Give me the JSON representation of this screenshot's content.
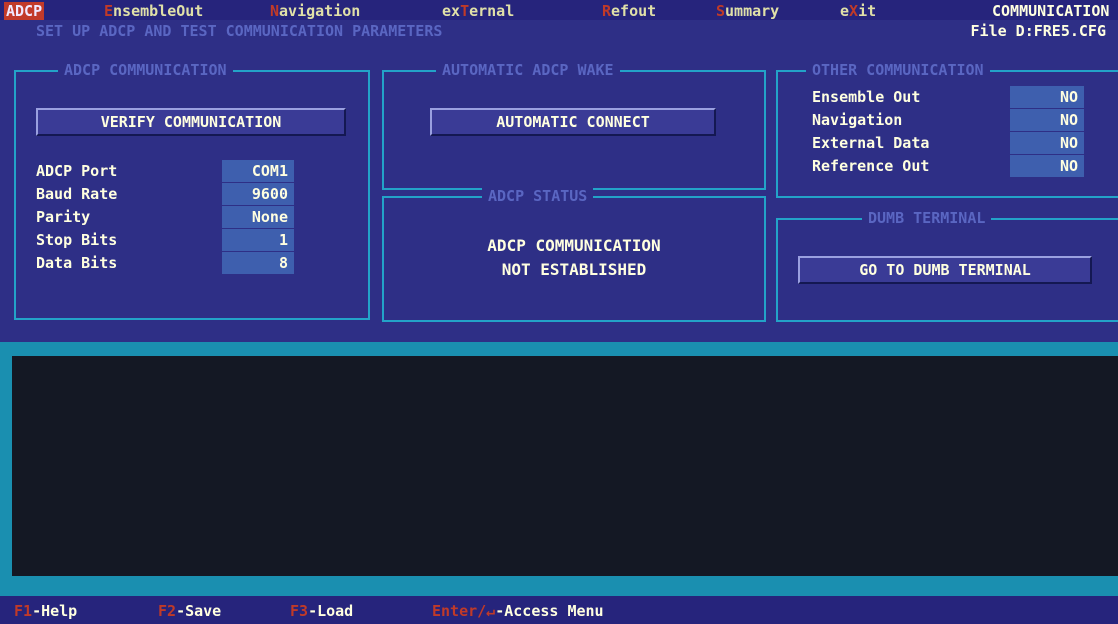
{
  "menu": {
    "adcp": "ADCP",
    "ensemble_hot": "E",
    "ensemble_rest": "nsembleOut",
    "nav_hot": "N",
    "nav_rest": "avigation",
    "ext_pre": "ex",
    "ext_hot": "T",
    "ext_rest": "ernal",
    "ref_hot": "R",
    "ref_rest": "efout",
    "sum_hot": "S",
    "sum_rest": "ummary",
    "exit_pre": "e",
    "exit_hot": "X",
    "exit_rest": "it",
    "current_screen": "COMMUNICATION"
  },
  "header": {
    "subtitle": "SET UP ADCP AND TEST COMMUNICATION PARAMETERS",
    "file": "File D:FRE5.CFG"
  },
  "adcp_comm": {
    "title": "ADCP COMMUNICATION",
    "verify_button": "VERIFY COMMUNICATION",
    "fields": [
      {
        "label": "ADCP Port",
        "value": "COM1"
      },
      {
        "label": "Baud Rate",
        "value": "9600"
      },
      {
        "label": "Parity",
        "value": "None"
      },
      {
        "label": "Stop Bits",
        "value": "1"
      },
      {
        "label": "Data Bits",
        "value": "8"
      }
    ]
  },
  "auto_wake": {
    "title": "AUTOMATIC ADCP WAKE",
    "connect_button": "AUTOMATIC CONNECT"
  },
  "adcp_status": {
    "title": "ADCP STATUS",
    "line1": "ADCP COMMUNICATION",
    "line2": "NOT ESTABLISHED"
  },
  "other_comm": {
    "title": "OTHER COMMUNICATION",
    "items": [
      {
        "label": "Ensemble Out",
        "value": "NO"
      },
      {
        "label": "Navigation",
        "value": "NO"
      },
      {
        "label": "External Data",
        "value": "NO"
      },
      {
        "label": "Reference Out",
        "value": "NO"
      }
    ]
  },
  "dumb_terminal": {
    "title": "DUMB TERMINAL",
    "button": "GO TO DUMB TERMINAL"
  },
  "statusbar": {
    "f1_key": "F1",
    "f1_text": "-Help",
    "f2_key": "F2",
    "f2_text": "-Save",
    "f3_key": "F3",
    "f3_text": "-Load",
    "enter_key": "Enter/↵",
    "enter_text": "-Access Menu"
  },
  "colors": {
    "panel_bg": "#2e2f86",
    "menubar_bg": "#26247c",
    "border_cyan": "#23a3c8",
    "hotkey_red": "#c03a28",
    "text_yellow": "#ffffe0",
    "field_bg": "#3e5fae",
    "output_bg": "#141824"
  }
}
